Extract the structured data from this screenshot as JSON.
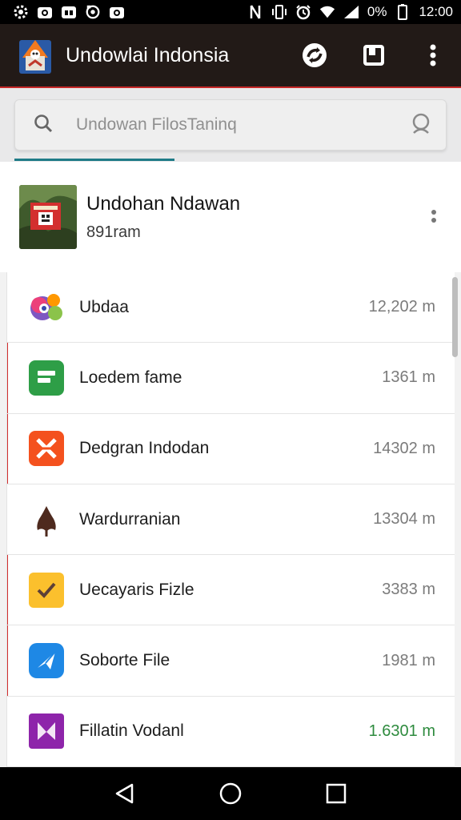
{
  "status_bar": {
    "battery_text": "0%",
    "time": "12:00",
    "icons": [
      "settings-icon",
      "camera-icon",
      "briefcase-icon",
      "sync-icon",
      "camera-icon",
      "nfc-icon",
      "vibrate-icon",
      "alarm-icon",
      "wifi-icon",
      "signal-icon",
      "battery-icon"
    ]
  },
  "app_bar": {
    "title": "Undowlai Indonsia",
    "logo": "app-logo",
    "actions": [
      "sync-action-icon",
      "bookmark-icon",
      "more-vert-icon"
    ],
    "accent_color": "#c62828"
  },
  "search": {
    "placeholder": "Undowan FilosTaninq",
    "left_icon": "search-icon",
    "right_icon": "voice-search-icon",
    "indicator_color": "#1e7b87"
  },
  "header": {
    "title": "Undohan Ndawan",
    "subtitle": "891ram"
  },
  "items": [
    {
      "label": "Ubdaa",
      "size": "12,202 m",
      "icon": "colorful-app-icon",
      "flagged": false,
      "size_color": "gray"
    },
    {
      "label": "Loedem fame",
      "size": "1361 m",
      "icon": "green-sheets-icon",
      "flagged": true,
      "size_color": "gray"
    },
    {
      "label": "Dedgran Indodan",
      "size": "14302 m",
      "icon": "orange-x-icon",
      "flagged": true,
      "size_color": "gray"
    },
    {
      "label": "Wardurranian",
      "size": "13304 m",
      "icon": "leaf-icon",
      "flagged": false,
      "size_color": "gray"
    },
    {
      "label": "Uecayaris Fizle",
      "size": "3383 m",
      "icon": "yellow-check-icon",
      "flagged": true,
      "size_color": "gray"
    },
    {
      "label": "Soborte File",
      "size": "1981 m",
      "icon": "blue-send-icon",
      "flagged": true,
      "size_color": "gray"
    },
    {
      "label": "Fillatin Vodanl",
      "size": "1.6301 m",
      "icon": "purple-bookmark-icon",
      "flagged": false,
      "size_color": "green"
    }
  ],
  "nav_bar": {
    "buttons": [
      "back-icon",
      "home-icon",
      "recents-icon"
    ]
  }
}
